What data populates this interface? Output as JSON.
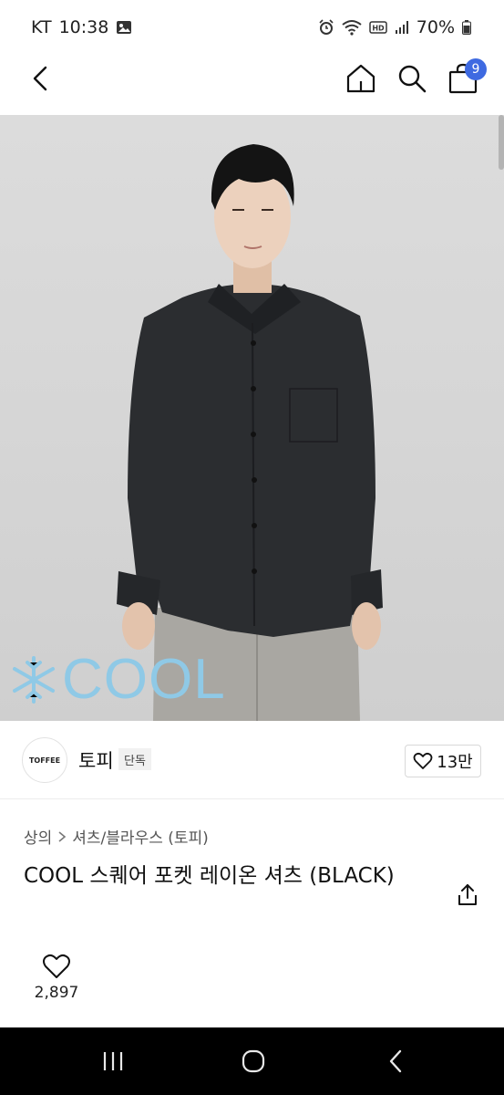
{
  "status_bar": {
    "carrier": "KT",
    "time": "10:38",
    "battery": "70%",
    "icons": [
      "gallery-icon",
      "alarm-icon",
      "wifi-icon",
      "hd-icon",
      "signal-icon",
      "battery-icon"
    ]
  },
  "nav": {
    "cart_count": "9",
    "icons": [
      "back-icon",
      "home-icon",
      "search-icon",
      "cart-icon"
    ]
  },
  "hero": {
    "overlay_text": "COOL"
  },
  "brand": {
    "logo_text": "TOFFEE",
    "name": "토피",
    "badge": "단독",
    "likes": "13만"
  },
  "breadcrumb": {
    "category": "상의",
    "subcategory": "셔츠/블라우스 (토피)"
  },
  "product": {
    "title": "COOL 스퀘어 포켓 레이온 셔츠 (BLACK)",
    "wish_count": "2,897"
  },
  "colors": {
    "accent": "#3e6ae1",
    "cool_text": "#8fc9e6"
  }
}
